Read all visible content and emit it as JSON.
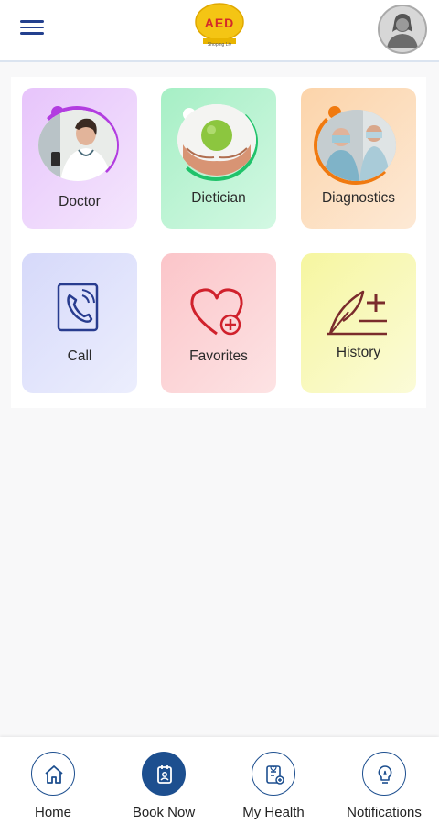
{
  "header": {
    "logo_text": "AED",
    "logo_subtext": "Shoping Liv"
  },
  "tiles": [
    {
      "label": "Doctor"
    },
    {
      "label": "Dietician"
    },
    {
      "label": "Diagnostics"
    },
    {
      "label": "Call"
    },
    {
      "label": "Favorites"
    },
    {
      "label": "History"
    }
  ],
  "bottom_nav": [
    {
      "label": "Home",
      "active": false
    },
    {
      "label": "Book Now",
      "active": true
    },
    {
      "label": "My Health",
      "active": false
    },
    {
      "label": "Notifications",
      "active": false
    }
  ],
  "colors": {
    "accent": "#1d4f8f",
    "header_icon": "#23408e",
    "doctor_tile": "#e6c3fb",
    "dietician_tile": "#a8f0c7",
    "diagnostics_tile": "#fcd8b1",
    "call_tile": "#d9dcfb",
    "favorites_tile": "#fbc9cc",
    "history_tile": "#f7f7a8"
  }
}
